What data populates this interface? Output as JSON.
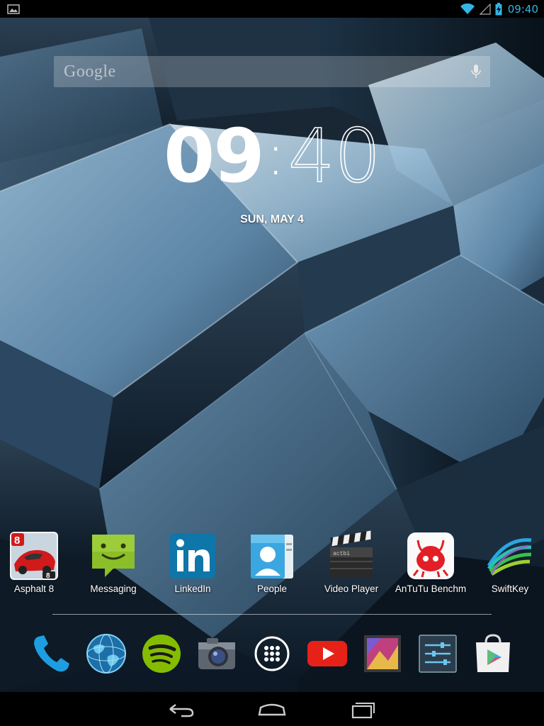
{
  "status": {
    "time": "09:40",
    "icons": [
      "image-notification-icon",
      "wifi-icon",
      "signal-icon",
      "battery-charging-icon"
    ],
    "accent": "#33b5e5"
  },
  "search": {
    "logo": "Google",
    "mic_icon": "microphone-icon"
  },
  "clock": {
    "hour": "09",
    "separator": ":",
    "minute": "40",
    "date": "SUN, MAY 4"
  },
  "apps": [
    {
      "label": "Asphalt 8",
      "icon": "asphalt-8-icon"
    },
    {
      "label": "Messaging",
      "icon": "messaging-icon"
    },
    {
      "label": "LinkedIn",
      "icon": "linkedin-icon"
    },
    {
      "label": "People",
      "icon": "people-icon"
    },
    {
      "label": "Video Player",
      "icon": "video-player-icon"
    },
    {
      "label": "AnTuTu Benchm",
      "icon": "antutu-icon"
    },
    {
      "label": "SwiftKey",
      "icon": "swiftkey-icon"
    }
  ],
  "dock": [
    {
      "icon": "phone-icon"
    },
    {
      "icon": "browser-globe-icon"
    },
    {
      "icon": "spotify-icon"
    },
    {
      "icon": "camera-icon"
    },
    {
      "icon": "all-apps-icon"
    },
    {
      "icon": "youtube-icon"
    },
    {
      "icon": "gallery-icon"
    },
    {
      "icon": "settings-icon"
    },
    {
      "icon": "play-store-icon"
    }
  ],
  "nav": [
    {
      "icon": "back-icon"
    },
    {
      "icon": "home-icon"
    },
    {
      "icon": "recent-apps-icon"
    }
  ]
}
